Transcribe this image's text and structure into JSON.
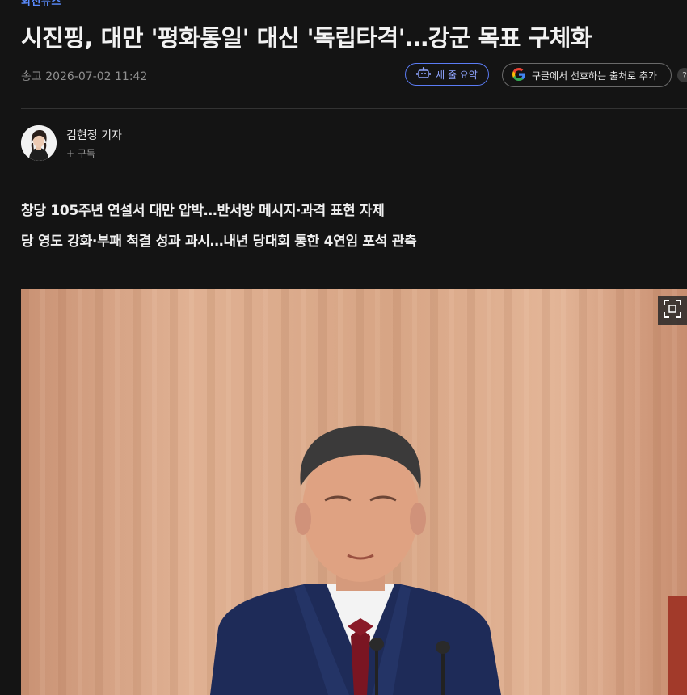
{
  "article": {
    "section": "외신뉴스",
    "title": "시진핑, 대만 '평화통일' 대신 '독립타격'…강군 목표 구체화",
    "meta": "송고 2026-07-02 11:42",
    "subheads": [
      "창당 105주년 연설서 대만 압박…반서방 메시지·과격 표현 자제",
      "당 영도 강화·부패 척결 성과 과시…내년 당대회 통한 4연임 포석 관측"
    ]
  },
  "toolbar": {
    "summary_label": "세 줄 요약",
    "google_label": "구글에서 선호하는 출처로 추가",
    "help_label": "?"
  },
  "author": {
    "name": "김현정 기자",
    "subscribe": "+ 구독"
  },
  "colors": {
    "background": "#141414",
    "accent": "#5b7cf5",
    "photo_backdrop": "#d9a888"
  },
  "icons": [
    "robot-icon",
    "google-logo-icon",
    "expand-icon"
  ]
}
